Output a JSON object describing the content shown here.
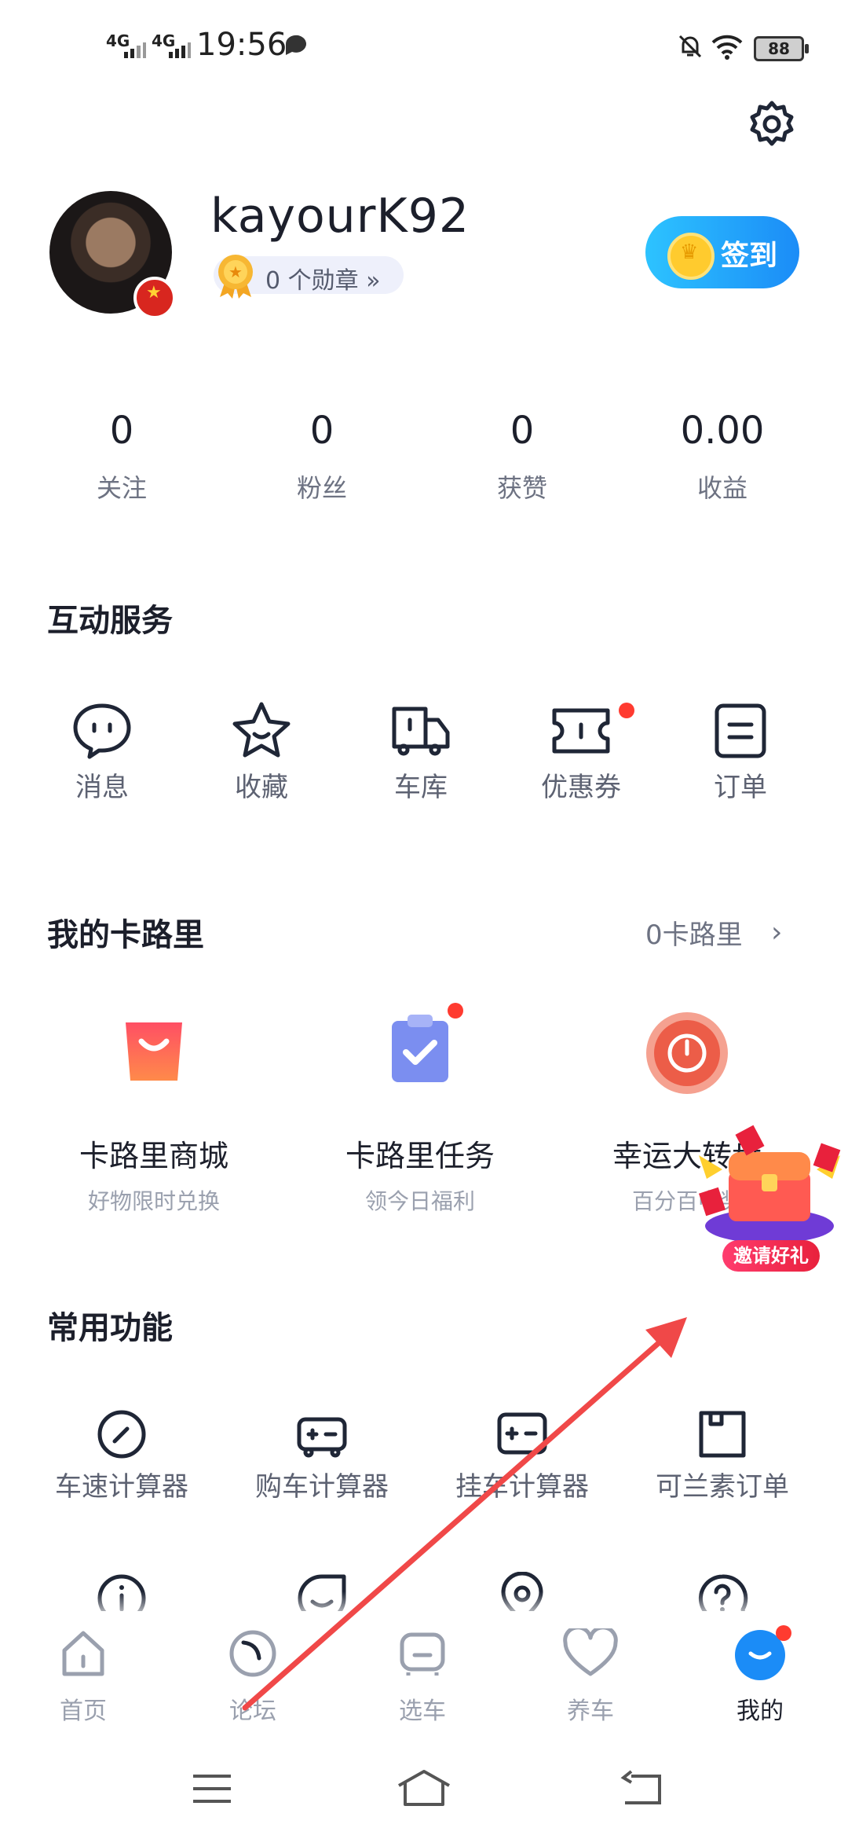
{
  "status_bar": {
    "signal1": "4G",
    "signal2": "4G",
    "time": "19:56",
    "battery": "88"
  },
  "profile": {
    "username": "kayourK92",
    "medal_text": "0 个勋章 »",
    "checkin_label": "签到"
  },
  "stats": [
    {
      "value": "0",
      "label": "关注"
    },
    {
      "value": "0",
      "label": "粉丝"
    },
    {
      "value": "0",
      "label": "获赞"
    },
    {
      "value": "0.00",
      "label": "收益"
    }
  ],
  "interactive_services": {
    "title": "互动服务",
    "items": [
      {
        "label": "消息",
        "icon": "message-icon"
      },
      {
        "label": "收藏",
        "icon": "star-icon"
      },
      {
        "label": "车库",
        "icon": "garage-truck-icon"
      },
      {
        "label": "优惠券",
        "icon": "coupon-icon"
      },
      {
        "label": "订单",
        "icon": "order-icon"
      }
    ]
  },
  "calories": {
    "title": "我的卡路里",
    "balance": "0卡路里",
    "cards": [
      {
        "title": "卡路里商城",
        "subtitle": "好物限时兑换",
        "icon": "shopping-bag-icon",
        "color": "#ff5a5f"
      },
      {
        "title": "卡路里任务",
        "subtitle": "领今日福利",
        "icon": "clipboard-check-icon",
        "color": "#7c8cf0"
      },
      {
        "title": "幸运大转盘",
        "subtitle": "百分百中奖",
        "icon": "spin-wheel-icon",
        "color": "#f06a55"
      }
    ]
  },
  "invite": {
    "label": "邀请好礼"
  },
  "common_functions": {
    "title": "常用功能",
    "items": [
      {
        "label": "车速计算器",
        "icon": "speedometer-icon"
      },
      {
        "label": "购车计算器",
        "icon": "car-calculator-icon"
      },
      {
        "label": "挂车计算器",
        "icon": "trailer-calculator-icon"
      },
      {
        "label": "可兰素订单",
        "icon": "order-box-icon"
      },
      {
        "label": "",
        "icon": "info-icon"
      },
      {
        "label": "",
        "icon": "smile-chat-icon"
      },
      {
        "label": "",
        "icon": "location-icon"
      },
      {
        "label": "",
        "icon": "question-icon"
      }
    ]
  },
  "bottom_nav": [
    {
      "label": "首页",
      "icon": "home-icon"
    },
    {
      "label": "论坛",
      "icon": "forum-icon"
    },
    {
      "label": "选车",
      "icon": "car-icon"
    },
    {
      "label": "养车",
      "icon": "heart-icon"
    },
    {
      "label": "我的",
      "icon": "profile-icon"
    }
  ],
  "colors": {
    "accent": "#1b8cf7",
    "red_dot": "#ff3b30",
    "arrow": "#f04848"
  }
}
